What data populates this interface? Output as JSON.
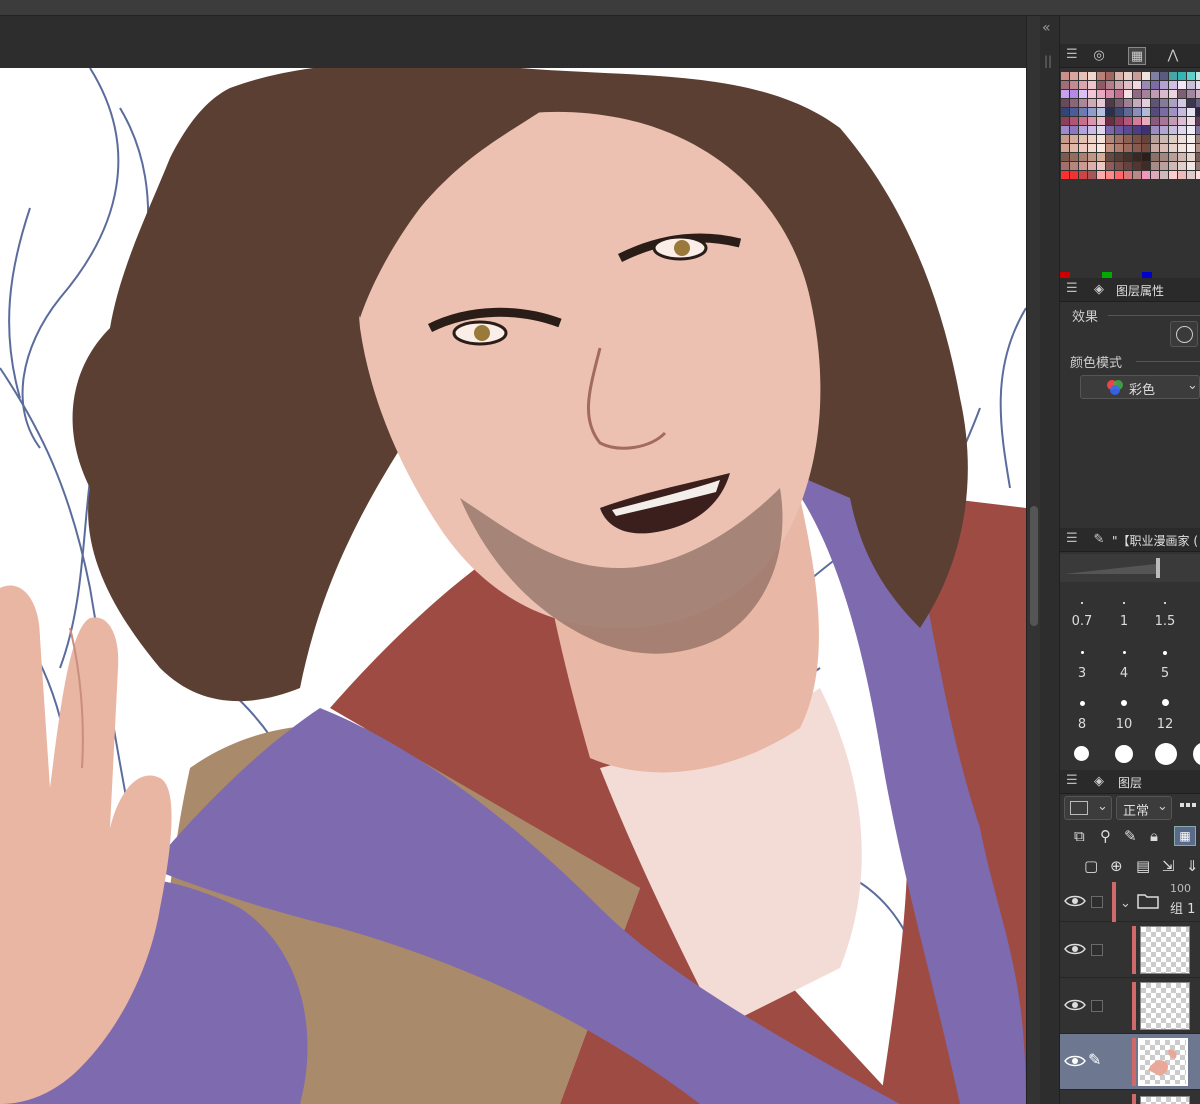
{
  "panels": {
    "layer_property": {
      "title": "图层属性",
      "effect_label": "效果",
      "color_mode_label": "颜色模式",
      "color_mode_value": "彩色"
    },
    "brush_size": {
      "title": "\"【职业漫画家 (",
      "sizes": [
        "0.7",
        "1",
        "1.5",
        "3",
        "4",
        "5",
        "8",
        "10",
        "12"
      ]
    },
    "layers": {
      "title": "图层",
      "blend_mode": "正常",
      "group_opacity": "100",
      "group_name": "组 1"
    }
  },
  "colors": {
    "ui_bg": "#323232",
    "selected_layer": "#6d7890",
    "canvas": "#ffffff",
    "purple_cloth": "#7e6aae",
    "red_cloth": "#9e4b43",
    "tan_cloth": "#a98a6a",
    "hair": "#5b3f33",
    "skin": "#e8b8a8"
  },
  "swatches": [
    "#c98f8a",
    "#d9a79f",
    "#e8c0b7",
    "#f3d6cc",
    "#b98078",
    "#a0665f",
    "#d7b0a8",
    "#e9cfc7",
    "#c99c96",
    "#efe1dc",
    "#7f7fa6",
    "#5b5b80",
    "#48a7a6",
    "#35b6b4",
    "#5fd0cc",
    "#c6e7e4",
    "#a36d78",
    "#c28b93",
    "#d9a6ad",
    "#ecc5ca",
    "#8f5a66",
    "#b67c88",
    "#caa0a9",
    "#e2bec6",
    "#f0d8dc",
    "#9a88b6",
    "#7d6ba6",
    "#b6a2d2",
    "#d1c0e6",
    "#f1e6f6",
    "#c8c0d8",
    "#e6e0ef",
    "#c6a1f0",
    "#b38be6",
    "#d9c0f6",
    "#f2c6d7",
    "#e8a9c0",
    "#d88ba8",
    "#c16f8f",
    "#f7dde6",
    "#8f6a82",
    "#a98099",
    "#c19bb2",
    "#dbbacb",
    "#ecd3df",
    "#7c5f73",
    "#a387a0",
    "#cbb0c6",
    "#6a4a5a",
    "#8b6676",
    "#ad8796",
    "#cfaab7",
    "#e7c9d3",
    "#4f3b48",
    "#745a6b",
    "#9e8093",
    "#c7a9bc",
    "#e3cfdc",
    "#5e5670",
    "#857b98",
    "#aca1c0",
    "#d3c9e2",
    "#3c3650",
    "#67607d",
    "#334477",
    "#4a5c99",
    "#6a7bb8",
    "#8e9cd0",
    "#b4c0e4",
    "#2b2f4f",
    "#3f4873",
    "#5e6997",
    "#8790ba",
    "#b2b9d8",
    "#564a7c",
    "#7a6ca3",
    "#9f92c5",
    "#c5bbe0",
    "#e8e1f3",
    "#2e2640",
    "#8c3f58",
    "#b05473",
    "#c96f8c",
    "#dd95ad",
    "#ecbccc",
    "#6b2d44",
    "#903c5c",
    "#b65678",
    "#d27d99",
    "#e9aabe",
    "#8a5a7a",
    "#a87596",
    "#c49ab5",
    "#dcbdd1",
    "#f1dde9",
    "#5d3c55",
    "#9f8acb",
    "#8e78bd",
    "#b4a2da",
    "#cbbde6",
    "#e1d7f0",
    "#7a66ab",
    "#6a57a0",
    "#5b4a93",
    "#4d3e84",
    "#3f3274",
    "#9c8cc0",
    "#b2a5cf",
    "#c8bede",
    "#ded7ed",
    "#f1edf7",
    "#7f729f",
    "#c79a8a",
    "#d6ad9d",
    "#e3c0b1",
    "#edd2c5",
    "#f5e3da",
    "#b3857a",
    "#a07166",
    "#8d6056",
    "#7a5048",
    "#68423b",
    "#b8a09a",
    "#ccb7b1",
    "#ddcbc6",
    "#ecdeda",
    "#f8eeeb",
    "#9e8580",
    "#d4a493",
    "#e2b8a8",
    "#eec9bb",
    "#f6d9cd",
    "#fae8df",
    "#c48f7d",
    "#b07c6b",
    "#9c6a5a",
    "#895a4b",
    "#764c3e",
    "#c9aaa0",
    "#d9bdb4",
    "#e6d0c8",
    "#f1e2dc",
    "#faf1ed",
    "#b09086",
    "#7d5a4e",
    "#936d5f",
    "#aa8171",
    "#c09684",
    "#d5ac99",
    "#664a40",
    "#553d35",
    "#46322c",
    "#382824",
    "#2b1f1c",
    "#8a7069",
    "#a18780",
    "#b89f98",
    "#cfb8b2",
    "#e5d3cd",
    "#725c56",
    "#a26f6a",
    "#b8847e",
    "#cc9993",
    "#dcb0aa",
    "#ebc8c3",
    "#8d5e59",
    "#784f4b",
    "#64423e",
    "#513632",
    "#402b28",
    "#a68b87",
    "#baa19d",
    "#ceb9b5",
    "#e0d0cd",
    "#f0e6e4",
    "#8f7672",
    "#ff2f2f",
    "#e33",
    "#c44",
    "#a55",
    "#faa",
    "#f88",
    "#f66",
    "#d77",
    "#b88",
    "#e9b",
    "#dab",
    "#cbb",
    "#fcc",
    "#ebb",
    "#dcc",
    "#fdd"
  ],
  "swatch_bottom": [
    "#cc0000",
    "#111",
    "#333",
    "#00aa00",
    "#222",
    "#2b2b2b",
    "#0000cc",
    "#444"
  ]
}
